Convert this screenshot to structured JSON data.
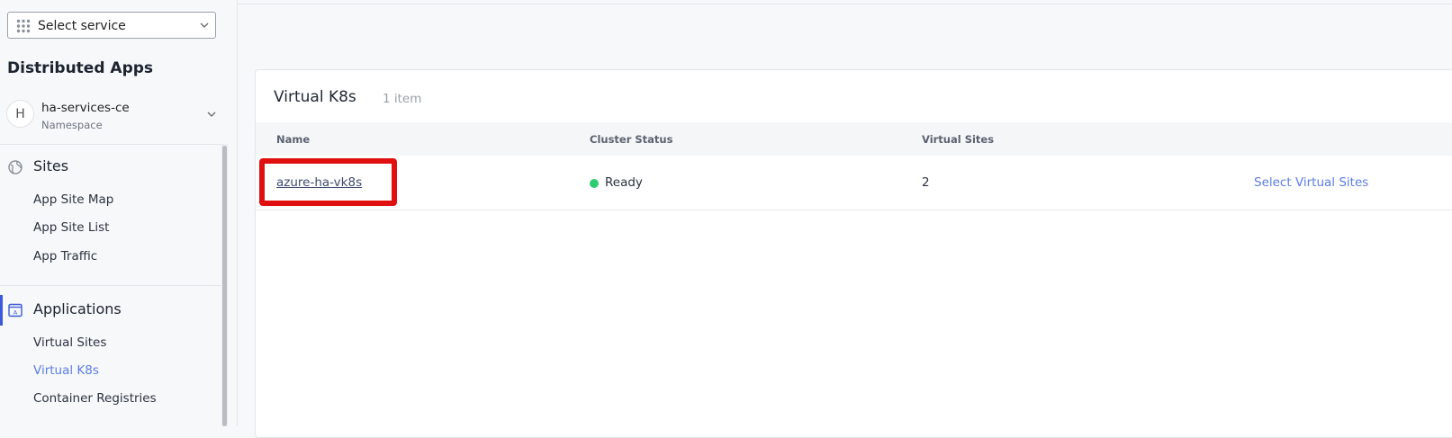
{
  "sidebar": {
    "service_select": {
      "label": "Select service"
    },
    "app_title": "Distributed Apps",
    "namespace": {
      "initial": "H",
      "name": "ha-services-ce",
      "sub": "Namespace"
    },
    "sections": [
      {
        "title": "Sites",
        "icon": "globe-icon",
        "items": [
          {
            "label": "App Site Map"
          },
          {
            "label": "App Site List"
          },
          {
            "label": "App Traffic"
          }
        ]
      },
      {
        "title": "Applications",
        "icon": "app-icon",
        "items": [
          {
            "label": "Virtual Sites"
          },
          {
            "label": "Virtual K8s",
            "active": true
          },
          {
            "label": "Container Registries"
          }
        ]
      }
    ]
  },
  "main": {
    "card": {
      "title": "Virtual K8s",
      "count": "1 item",
      "columns": [
        "Name",
        "Cluster Status",
        "Virtual Sites"
      ],
      "rows": [
        {
          "name": "azure-ha-vk8s",
          "status": "Ready",
          "virtual_sites": "2",
          "action": "Select Virtual Sites"
        }
      ]
    }
  },
  "colors": {
    "accent": "#5b7de6",
    "status_ready": "#2ecc71",
    "highlight": "#e01010"
  }
}
